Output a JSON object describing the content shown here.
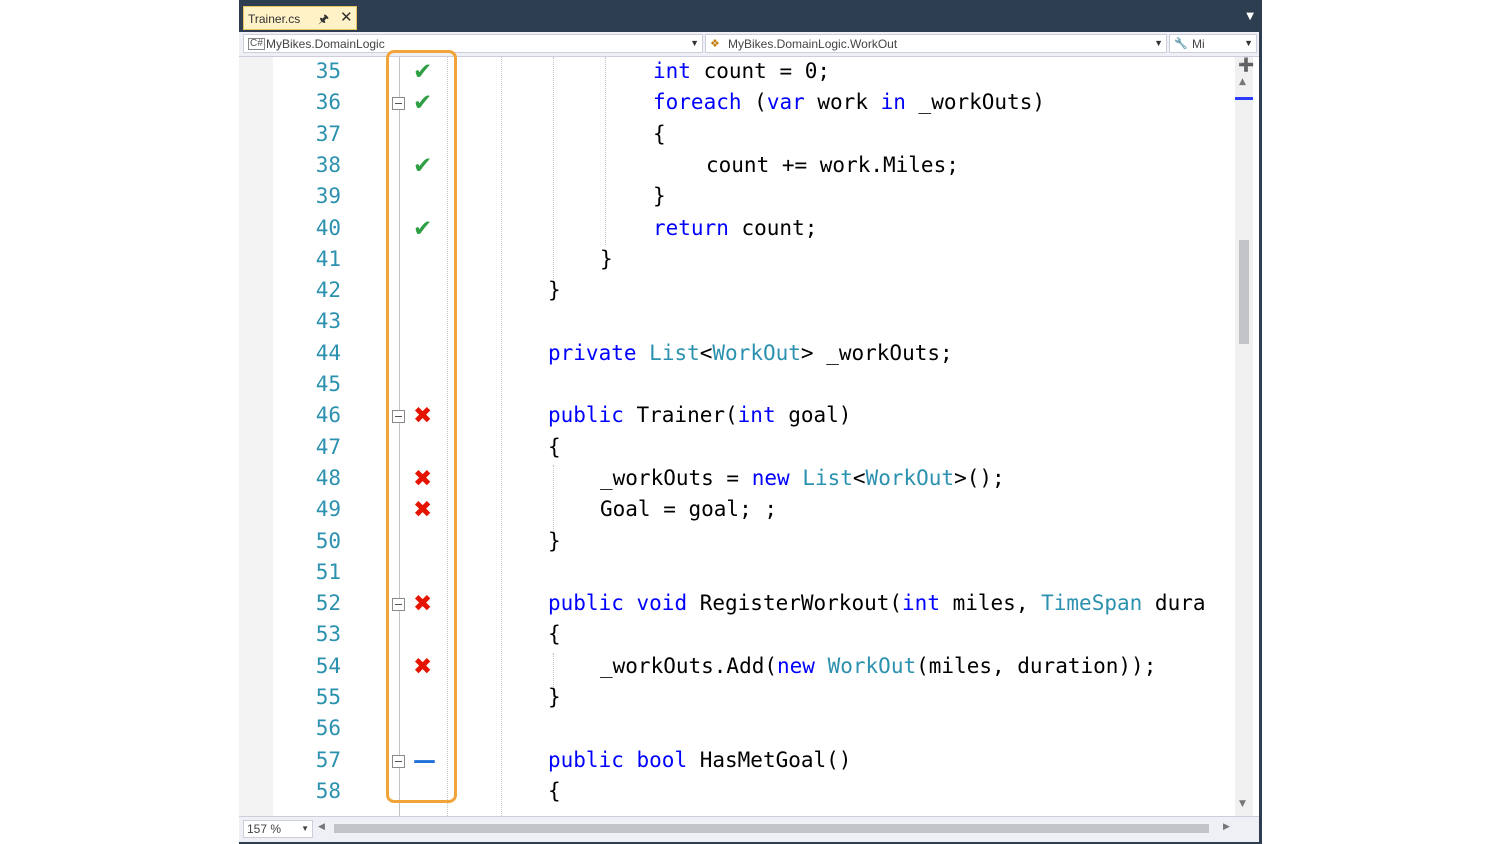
{
  "tab": {
    "title": "Trainer.cs",
    "pin_icon": "pin-icon",
    "close_icon": "close-icon"
  },
  "navbar": {
    "project_combo": "MyBikes.DomainLogic",
    "type_combo": "MyBikes.DomainLogic.WorkOut",
    "member_combo": "Mi"
  },
  "colors": {
    "covered": "#2ea043",
    "not_covered": "#e51400",
    "partial": "#1e6fd9",
    "highlight": "#f0a43a",
    "keyword": "#0000ff",
    "type": "#2b91af",
    "line_number": "#2b91af"
  },
  "lines": [
    {
      "n": "35",
      "coverage": "covered"
    },
    {
      "n": "36",
      "coverage": "covered",
      "fold": true
    },
    {
      "n": "37"
    },
    {
      "n": "38",
      "coverage": "covered"
    },
    {
      "n": "39"
    },
    {
      "n": "40",
      "coverage": "covered"
    },
    {
      "n": "41"
    },
    {
      "n": "42"
    },
    {
      "n": "43"
    },
    {
      "n": "44"
    },
    {
      "n": "45"
    },
    {
      "n": "46",
      "coverage": "not_covered",
      "fold": true
    },
    {
      "n": "47"
    },
    {
      "n": "48",
      "coverage": "not_covered"
    },
    {
      "n": "49",
      "coverage": "not_covered"
    },
    {
      "n": "50"
    },
    {
      "n": "51"
    },
    {
      "n": "52",
      "coverage": "not_covered",
      "fold": true
    },
    {
      "n": "53"
    },
    {
      "n": "54",
      "coverage": "not_covered"
    },
    {
      "n": "55"
    },
    {
      "n": "56"
    },
    {
      "n": "57",
      "coverage": "partial",
      "fold": true
    },
    {
      "n": "58"
    }
  ],
  "code": {
    "l35": {
      "kw1": "int",
      "rest": " count = 0;"
    },
    "l36": {
      "kw1": "foreach",
      "p1": " (",
      "kw2": "var",
      "p2": " work ",
      "kw3": "in",
      "p3": " _workOuts)"
    },
    "l37": "{",
    "l38": "count += work.Miles;",
    "l39": "}",
    "l40": {
      "kw1": "return",
      "rest": " count;"
    },
    "l41": "}",
    "l42": "}",
    "l44": {
      "kw1": "private",
      "p1": " ",
      "t1": "List",
      "p2": "<",
      "t2": "WorkOut",
      "p3": "> _workOuts;"
    },
    "l46": {
      "kw1": "public",
      "p1": " Trainer(",
      "kw2": "int",
      "p2": " goal)"
    },
    "l47": "{",
    "l48": {
      "p1": "_workOuts = ",
      "kw1": "new",
      "p2": " ",
      "t1": "List",
      "p3": "<",
      "t2": "WorkOut",
      "p4": ">();"
    },
    "l49": "Goal = goal; ;",
    "l50": "}",
    "l52": {
      "kw1": "public",
      "p1": " ",
      "kw2": "void",
      "p2": " RegisterWorkout(",
      "kw3": "int",
      "p3": " miles, ",
      "t1": "TimeSpan",
      "p4": " dura"
    },
    "l53": "{",
    "l54": {
      "p1": "_workOuts.Add(",
      "kw1": "new",
      "p2": " ",
      "t1": "WorkOut",
      "p3": "(miles, duration));"
    },
    "l55": "}",
    "l57": {
      "kw1": "public",
      "p1": " ",
      "kw2": "bool",
      "p2": " HasMetGoal()"
    },
    "l58": "{"
  },
  "status": {
    "zoom": "157 %"
  },
  "icons": {
    "covered": "check-icon",
    "not_covered": "cross-icon",
    "partial": "dash-icon",
    "fold": "collapse-icon"
  }
}
